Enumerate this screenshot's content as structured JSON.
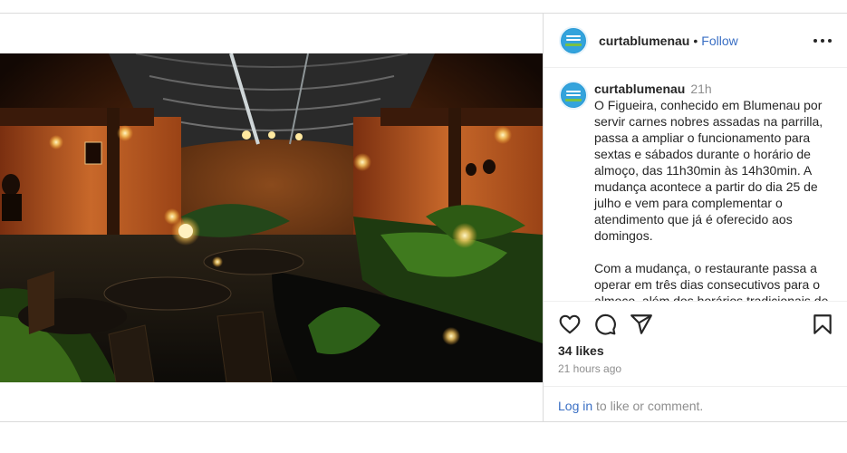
{
  "account": {
    "username": "curtablumenau",
    "separator": "•",
    "follow_label": "Follow"
  },
  "caption": {
    "username": "curtablumenau",
    "time": "21h",
    "paragraph1": "O Figueira, conhecido em Blumenau por servir carnes nobres assadas na parrilla, passa a ampliar o funcionamento para sextas e sábados durante o horário de almoço, das 11h30min às 14h30min.  A mudança acontece a partir do dia 25 de julho e vem para complementar o atendimento que já é oferecido aos domingos.",
    "paragraph2": "Com a mudança, o restaurante passa a operar em três dias consecutivos para o almoço, além dos horários tradicionais de"
  },
  "actions": {
    "icons": [
      "heart-icon",
      "comment-icon",
      "share-icon",
      "bookmark-icon"
    ]
  },
  "stats": {
    "likes": "34 likes",
    "posted": "21 hours ago"
  },
  "comment": {
    "login_label": "Log in",
    "rest": " to like or comment."
  }
}
